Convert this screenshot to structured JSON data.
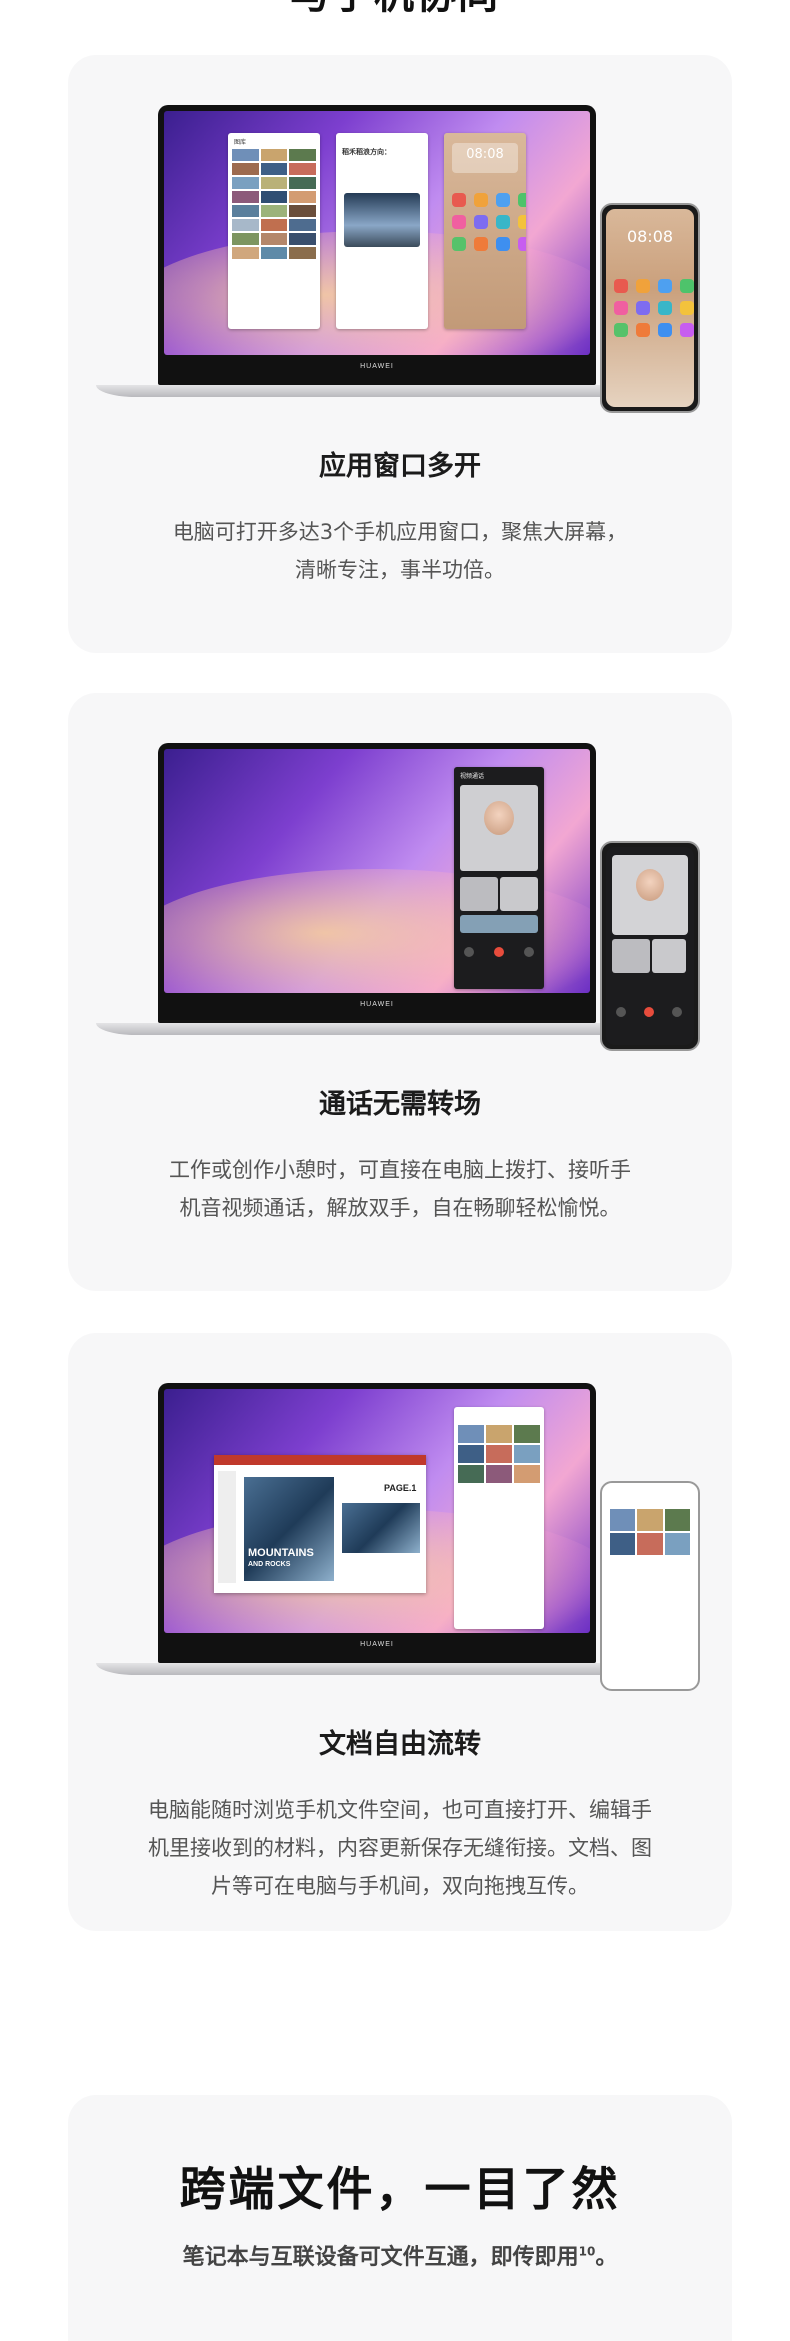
{
  "top_heading": "与手机协同",
  "laptop_brand": "HUAWEI",
  "phone_clock": "08:08",
  "window_labels": {
    "gallery_title": "图库",
    "note_title": "稻禾稻浪方向：",
    "call_title": "视频通话",
    "slide_headline": "MOUNTAINS",
    "slide_sub": "AND ROCKS",
    "slide_page": "PAGE.1"
  },
  "features": [
    {
      "title": "应用窗口多开",
      "desc_lines": [
        "电脑可打开多达3个手机应用窗口，聚焦大屏幕，",
        "清晰专注，事半功倍。"
      ]
    },
    {
      "title": "通话无需转场",
      "desc_lines": [
        "工作或创作小憩时，可直接在电脑上拨打、接听手",
        "机音视频通话，解放双手，自在畅聊轻松愉悦。"
      ]
    },
    {
      "title": "文档自由流转",
      "desc_lines": [
        "电脑能随时浏览手机文件空间，也可直接打开、编辑手",
        "机里接收到的材料，内容更新保存无缝衔接。文档、图",
        "片等可在电脑与手机间，双向拖拽互传。"
      ]
    }
  ],
  "section_file": {
    "title": "跨端文件，一目了然",
    "subtitle": "笔记本与互联设备可文件互通，即传即用",
    "footnote": "10",
    "end": "。"
  },
  "colors": {
    "card_bg": "#f7f7f8",
    "title": "#1b1b1b",
    "desc": "#555555"
  }
}
